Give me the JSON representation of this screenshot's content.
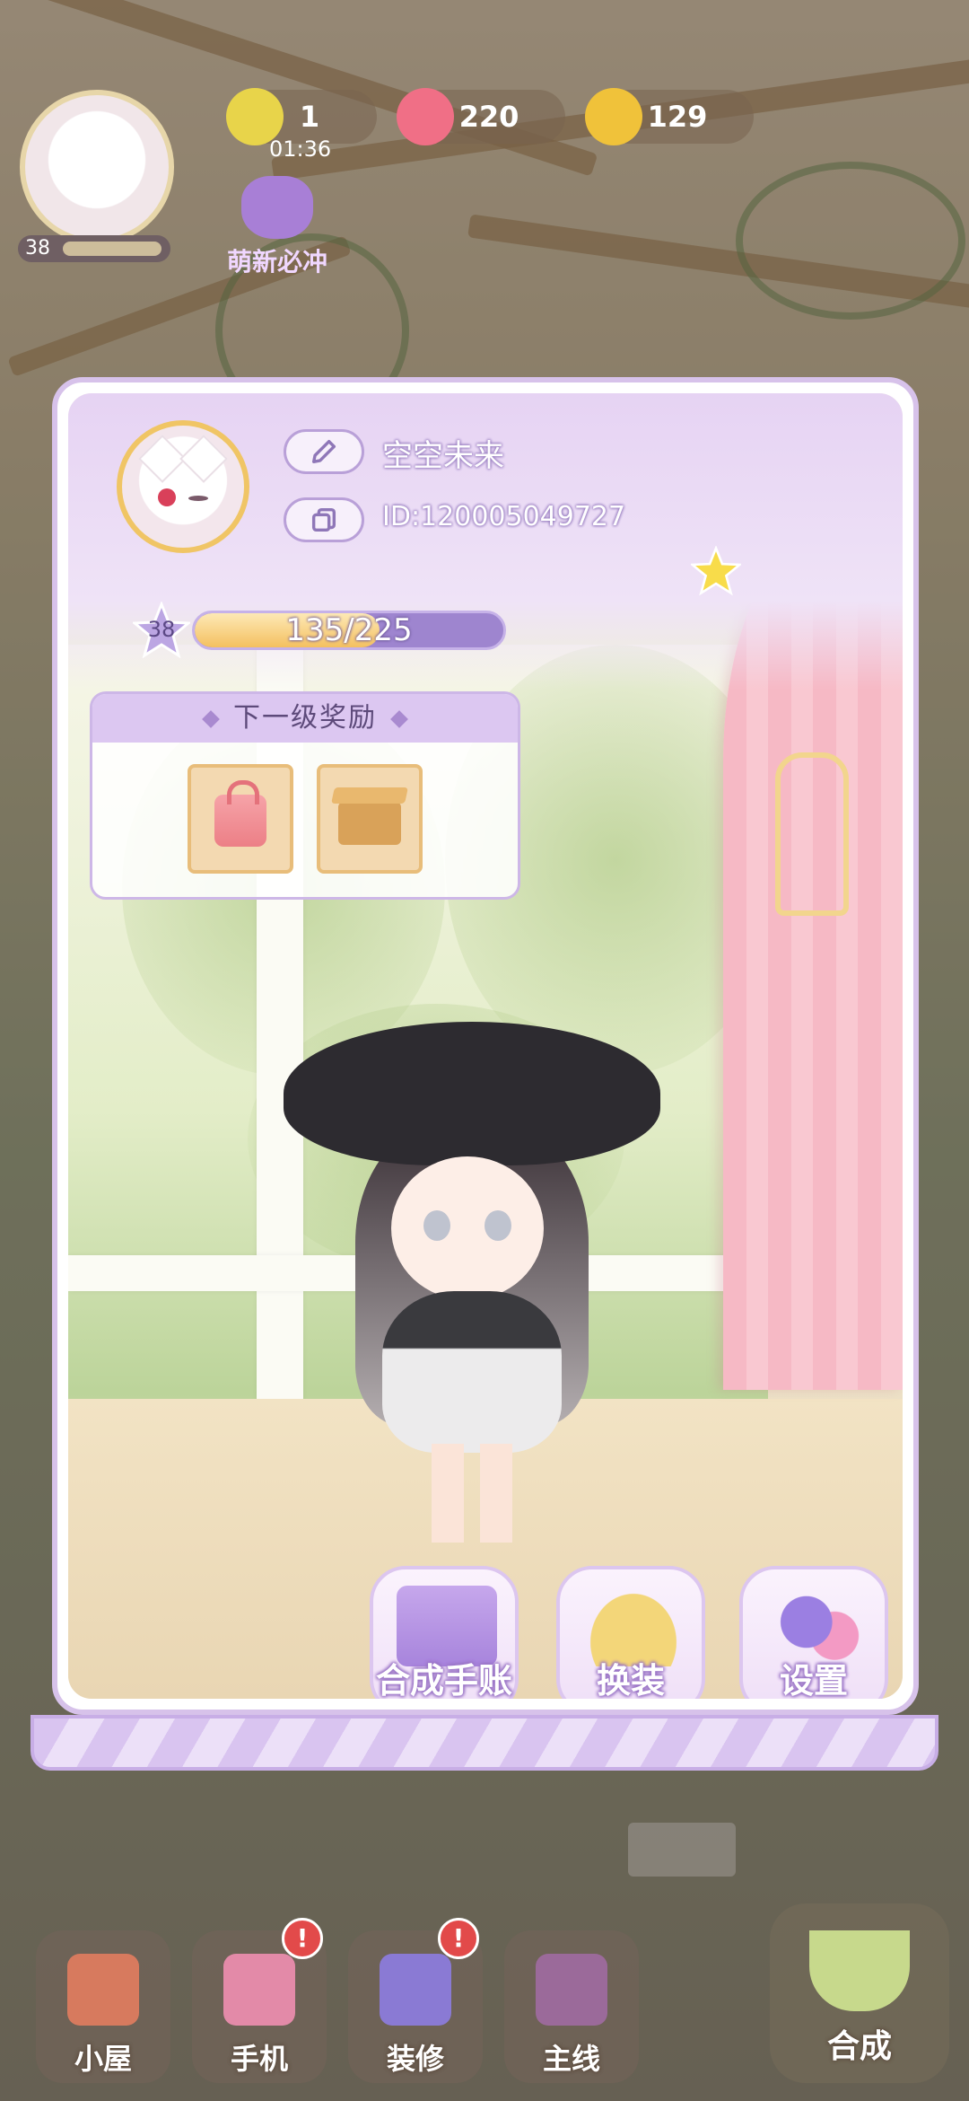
{
  "hud": {
    "energy_value": "1",
    "energy_timer": "01:36",
    "gems_value": "220",
    "coins_value": "129",
    "player_level": "38",
    "newbie_label": "萌新必冲"
  },
  "profile": {
    "nickname": "空空未来",
    "player_id": "ID:120005049727",
    "level": "38",
    "xp_text": "135/225",
    "xp_progress": 0.6
  },
  "reward": {
    "title": "下一级奖励",
    "items": [
      {
        "icon": "bag-icon"
      },
      {
        "icon": "item-box-icon"
      }
    ]
  },
  "actions": {
    "merge_journal": "合成手账",
    "dress_up": "换装",
    "settings": "设置"
  },
  "nav": {
    "house": "小屋",
    "phone": "手机",
    "decorate": "装修",
    "main_story": "主线",
    "merge": "合成",
    "phone_badge": "!",
    "decorate_badge": "!"
  },
  "colors": {
    "accent_purple": "#9e85cf",
    "panel_border": "#d7c2ea",
    "xp_fill": "#f4c060",
    "badge_red": "#e24a4a"
  }
}
